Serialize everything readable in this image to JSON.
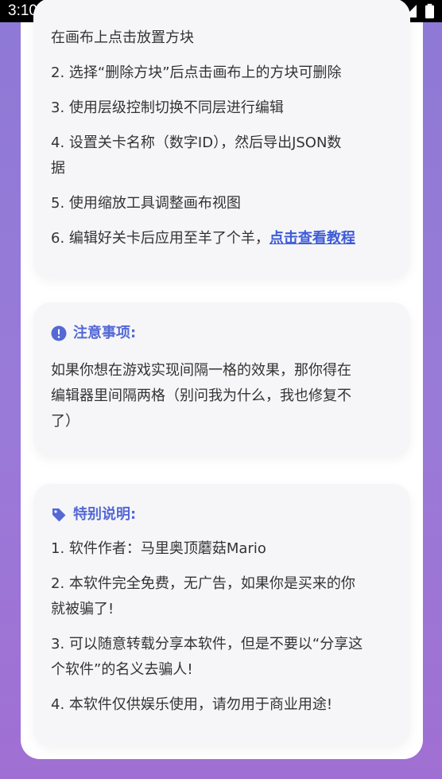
{
  "status_bar": {
    "time": "3:10"
  },
  "instructions_card": {
    "items": [
      "在画布上点击放置方块",
      "2. 选择“删除方块”后点击画布上的方块可删除",
      "3. 使用层级控制切换不同层进行编辑",
      "4. 设置关卡名称（数字ID），然后导出JSON数",
      "据",
      "5. 使用缩放工具调整画布视图",
      "6. 编辑好关卡后应用至羊了个羊，"
    ],
    "tutorial_link": "点击查看教程"
  },
  "notice_card": {
    "title": "注意事项:",
    "lines": [
      "如果你想在游戏实现间隔一格的效果，那你得在",
      "编辑器里间隔两格（别问我为什么，我也修复不",
      "了）"
    ]
  },
  "special_card": {
    "title": "特别说明:",
    "lines": [
      "1. 软件作者：马里奥顶蘑菇Mario",
      "2. 本软件完全免费，无广告，如果你是买来的你",
      "就被骗了!",
      "3. 可以随意转载分享本软件，但是不要以“分享这",
      "个软件”的名义去骗人!",
      "4. 本软件仅供娱乐使用，请勿用于商业用途!"
    ]
  },
  "colors": {
    "accent": "#5468d6",
    "link": "#3d5bd6",
    "background_top": "#8e79d6",
    "background_bottom": "#a06fd3",
    "card": "#f6f6f8"
  },
  "icons": {
    "notice": "exclamation-circle-icon",
    "special": "tag-icon"
  }
}
